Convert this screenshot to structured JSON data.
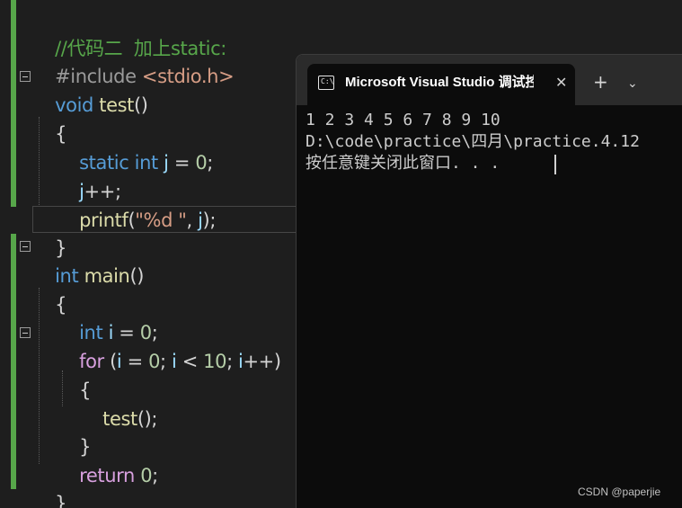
{
  "editor": {
    "comment": "//代码二  加上static:",
    "include_directive": "#include",
    "include_header": "<stdio.h>",
    "kw_void": "void",
    "kw_int": "int",
    "kw_static": "static",
    "kw_for": "for",
    "kw_return": "return",
    "fn_test": "test",
    "fn_main": "main",
    "fn_printf": "printf",
    "var_j": "j",
    "var_i": "i",
    "num_zero": "0",
    "num_ten": "10",
    "format_string": "\"%d \"",
    "open_brace": "{",
    "close_brace": "}",
    "parens": "()",
    "incr": "++;",
    "incr_plain": "++",
    "assign": " = ",
    "semicolon": ";",
    "semi_space": "; ",
    "less_than": " < ",
    "open_paren": "(",
    "close_paren": ")",
    "comma_space": ", ",
    "call_end": "();",
    "printf_end": ");"
  },
  "console": {
    "title": "Microsoft Visual Studio 调试控制台",
    "close_glyph": "✕",
    "new_tab_glyph": "+",
    "dropdown_glyph": "⌄",
    "icon_text": "C:\\",
    "output": [
      "1 2 3 4 5 6 7 8 9 10",
      "D:\\code\\practice\\四月\\practice.4.12",
      "按任意键关闭此窗口. . ."
    ]
  },
  "watermark": "CSDN @paperjie",
  "colors": {
    "editor_bg": "#1e1e1e",
    "keyword": "#569cd6",
    "control_keyword": "#d8a0df",
    "function": "#dcdcaa",
    "variable": "#9cdcfe",
    "number": "#b5cea8",
    "string": "#d69d85",
    "comment": "#57a64a",
    "console_bg": "#0c0c0c"
  }
}
